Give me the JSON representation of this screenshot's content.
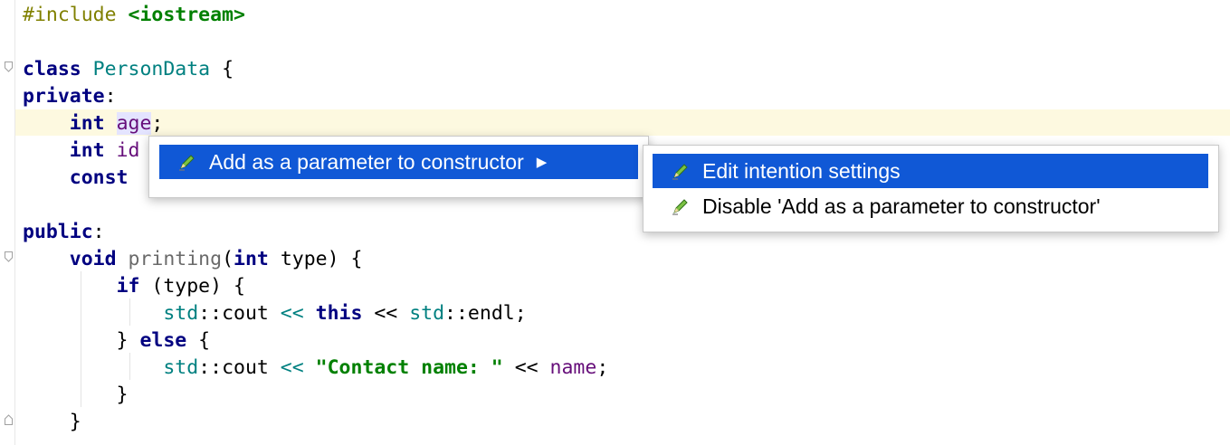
{
  "editor": {
    "lines": [
      [
        {
          "t": "#include ",
          "c": "pp"
        },
        {
          "t": "<iostream>",
          "c": "ppinc"
        }
      ],
      [],
      [
        {
          "t": "class ",
          "c": "kw"
        },
        {
          "t": "PersonData",
          "c": "cls"
        },
        {
          "t": " {",
          "c": ""
        }
      ],
      [
        {
          "t": "private",
          "c": "kw"
        },
        {
          "t": ":",
          "c": ""
        }
      ],
      [
        {
          "t": "    ",
          "c": ""
        },
        {
          "t": "int ",
          "c": "kw"
        },
        {
          "t": "age",
          "c": "fld usage"
        },
        {
          "t": ";",
          "c": ""
        }
      ],
      [
        {
          "t": "    ",
          "c": ""
        },
        {
          "t": "int ",
          "c": "kw"
        },
        {
          "t": "id",
          "c": "fld"
        }
      ],
      [
        {
          "t": "    ",
          "c": ""
        },
        {
          "t": "const ",
          "c": "kw"
        }
      ],
      [],
      [
        {
          "t": "public",
          "c": "kw"
        },
        {
          "t": ":",
          "c": ""
        }
      ],
      [
        {
          "t": "    ",
          "c": ""
        },
        {
          "t": "void ",
          "c": "kw"
        },
        {
          "t": "printing",
          "c": "fn"
        },
        {
          "t": "(",
          "c": ""
        },
        {
          "t": "int ",
          "c": "kw"
        },
        {
          "t": "type) {",
          "c": ""
        }
      ],
      [
        {
          "t": "        ",
          "c": ""
        },
        {
          "t": "if ",
          "c": "kw"
        },
        {
          "t": "(type) {",
          "c": ""
        }
      ],
      [
        {
          "t": "            ",
          "c": ""
        },
        {
          "t": "std",
          "c": "ns"
        },
        {
          "t": "::cout ",
          "c": ""
        },
        {
          "t": "<<",
          "c": "op"
        },
        {
          "t": " ",
          "c": ""
        },
        {
          "t": "this",
          "c": "kw"
        },
        {
          "t": " << ",
          "c": ""
        },
        {
          "t": "std",
          "c": "ns"
        },
        {
          "t": "::endl;",
          "c": ""
        }
      ],
      [
        {
          "t": "        } ",
          "c": ""
        },
        {
          "t": "else",
          "c": "kw"
        },
        {
          "t": " {",
          "c": ""
        }
      ],
      [
        {
          "t": "            ",
          "c": ""
        },
        {
          "t": "std",
          "c": "ns"
        },
        {
          "t": "::cout ",
          "c": ""
        },
        {
          "t": "<<",
          "c": "op"
        },
        {
          "t": " ",
          "c": ""
        },
        {
          "t": "\"Contact name: \"",
          "c": "str"
        },
        {
          "t": " << ",
          "c": ""
        },
        {
          "t": "name",
          "c": "fld"
        },
        {
          "t": ";",
          "c": ""
        }
      ],
      [
        {
          "t": "        }",
          "c": ""
        }
      ],
      [
        {
          "t": "    }",
          "c": ""
        }
      ]
    ]
  },
  "intention_popup": {
    "item_label": "Add as a parameter to constructor",
    "icon": "pencil-bulb-icon"
  },
  "submenu": {
    "items": [
      {
        "label": "Edit intention settings",
        "icon": "pencil-bulb-icon",
        "selected": true
      },
      {
        "label": "Disable 'Add as a parameter to constructor'",
        "icon": "pencil-bulb-icon",
        "selected": false
      }
    ]
  },
  "colors": {
    "selection": "#1058d6",
    "current_line": "#fdf9e0",
    "keyword": "#000080",
    "string": "#008000",
    "field": "#660e7a",
    "class": "#008080"
  }
}
